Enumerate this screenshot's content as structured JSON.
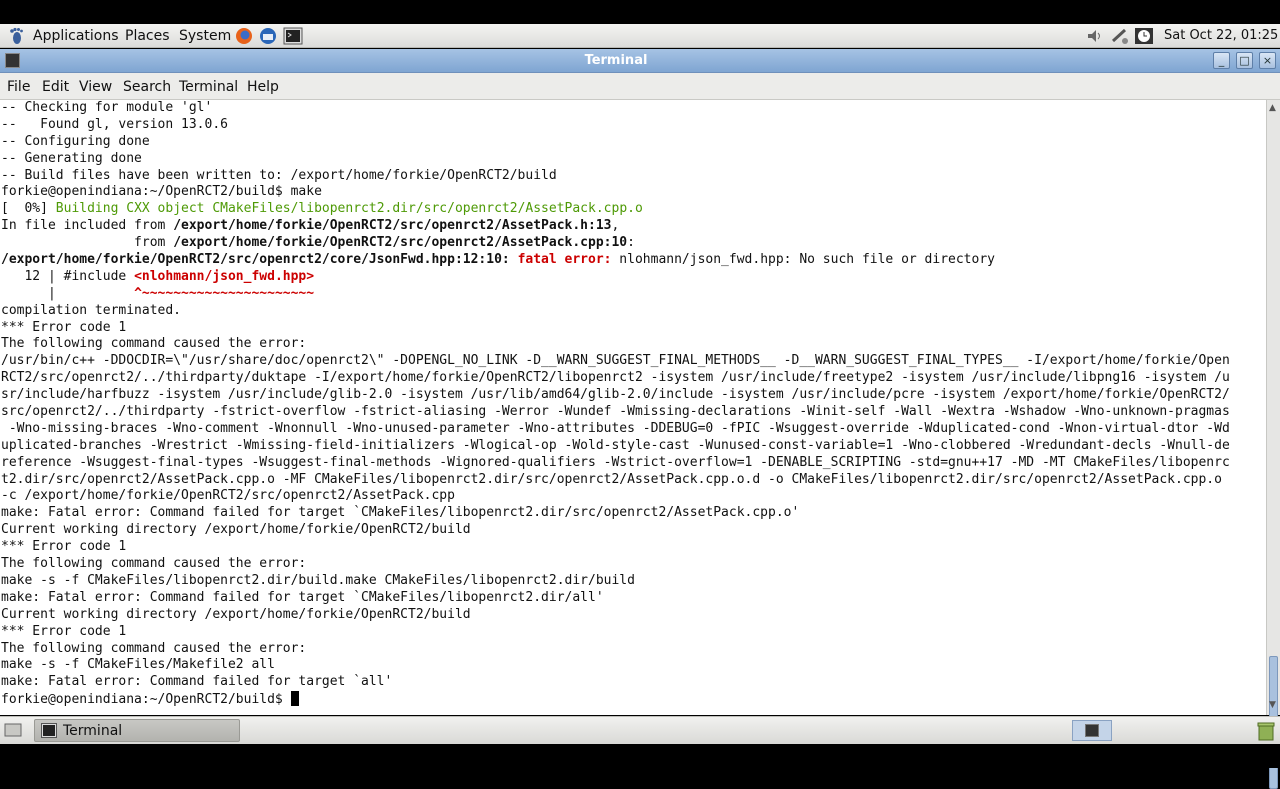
{
  "top_panel": {
    "menus": [
      "Applications",
      "Places",
      "System"
    ],
    "clock": "Sat Oct 22, 01:25"
  },
  "window": {
    "title": "Terminal",
    "menubar": [
      "File",
      "Edit",
      "View",
      "Search",
      "Terminal",
      "Help"
    ]
  },
  "terminal": {
    "prompt_last": "forkie@openindiana:~/OpenRCT2/build$ ",
    "lines": [
      [
        {
          "t": "-- Checking for module 'gl'"
        }
      ],
      [
        {
          "t": "--   Found gl, version 13.0.6"
        }
      ],
      [
        {
          "t": "-- Configuring done"
        }
      ],
      [
        {
          "t": "-- Generating done"
        }
      ],
      [
        {
          "t": "-- Build files have been written to: /export/home/forkie/OpenRCT2/build"
        }
      ],
      [
        {
          "t": "forkie@openindiana:~/OpenRCT2/build$ make"
        }
      ],
      [
        {
          "t": "[  0%] "
        },
        {
          "t": "Building CXX object CMakeFiles/libopenrct2.dir/src/openrct2/AssetPack.cpp.o",
          "s": "g"
        }
      ],
      [
        {
          "t": "In file included from "
        },
        {
          "t": "/export/home/forkie/OpenRCT2/src/openrct2/AssetPack.h:13",
          "s": "b"
        },
        {
          "t": ","
        }
      ],
      [
        {
          "t": "                 from "
        },
        {
          "t": "/export/home/forkie/OpenRCT2/src/openrct2/AssetPack.cpp:10",
          "s": "b"
        },
        {
          "t": ":"
        }
      ],
      [
        {
          "t": "/export/home/forkie/OpenRCT2/src/openrct2/core/JsonFwd.hpp:12:10:",
          "s": "b"
        },
        {
          "t": " "
        },
        {
          "t": "fatal error:",
          "s": "r"
        },
        {
          "t": " nlohmann/json_fwd.hpp: No such file or directory"
        }
      ],
      [
        {
          "t": "   12 | #include "
        },
        {
          "t": "<nlohmann/json_fwd.hpp>",
          "s": "r"
        }
      ],
      [
        {
          "t": "      |          "
        },
        {
          "t": "^~~~~~~~~~~~~~~~~~~~~~~",
          "s": "r"
        }
      ],
      [
        {
          "t": "compilation terminated."
        }
      ],
      [
        {
          "t": "*** Error code 1"
        }
      ],
      [
        {
          "t": "The following command caused the error:"
        }
      ],
      [
        {
          "t": "/usr/bin/c++ -DDOCDIR=\\\"/usr/share/doc/openrct2\\\" -DOPENGL_NO_LINK -D__WARN_SUGGEST_FINAL_METHODS__ -D__WARN_SUGGEST_FINAL_TYPES__ -I/export/home/forkie/Open"
        }
      ],
      [
        {
          "t": "RCT2/src/openrct2/../thirdparty/duktape -I/export/home/forkie/OpenRCT2/libopenrct2 -isystem /usr/include/freetype2 -isystem /usr/include/libpng16 -isystem /u"
        }
      ],
      [
        {
          "t": "sr/include/harfbuzz -isystem /usr/include/glib-2.0 -isystem /usr/lib/amd64/glib-2.0/include -isystem /usr/include/pcre -isystem /export/home/forkie/OpenRCT2/"
        }
      ],
      [
        {
          "t": "src/openrct2/../thirdparty -fstrict-overflow -fstrict-aliasing -Werror -Wundef -Wmissing-declarations -Winit-self -Wall -Wextra -Wshadow -Wno-unknown-pragmas"
        }
      ],
      [
        {
          "t": " -Wno-missing-braces -Wno-comment -Wnonnull -Wno-unused-parameter -Wno-attributes -DDEBUG=0 -fPIC -Wsuggest-override -Wduplicated-cond -Wnon-virtual-dtor -Wd"
        }
      ],
      [
        {
          "t": "uplicated-branches -Wrestrict -Wmissing-field-initializers -Wlogical-op -Wold-style-cast -Wunused-const-variable=1 -Wno-clobbered -Wredundant-decls -Wnull-de"
        }
      ],
      [
        {
          "t": "reference -Wsuggest-final-types -Wsuggest-final-methods -Wignored-qualifiers -Wstrict-overflow=1 -DENABLE_SCRIPTING -std=gnu++17 -MD -MT CMakeFiles/libopenrc"
        }
      ],
      [
        {
          "t": "t2.dir/src/openrct2/AssetPack.cpp.o -MF CMakeFiles/libopenrct2.dir/src/openrct2/AssetPack.cpp.o.d -o CMakeFiles/libopenrct2.dir/src/openrct2/AssetPack.cpp.o"
        }
      ],
      [
        {
          "t": "-c /export/home/forkie/OpenRCT2/src/openrct2/AssetPack.cpp"
        }
      ],
      [
        {
          "t": "make: Fatal error: Command failed for target `CMakeFiles/libopenrct2.dir/src/openrct2/AssetPack.cpp.o'"
        }
      ],
      [
        {
          "t": "Current working directory /export/home/forkie/OpenRCT2/build"
        }
      ],
      [
        {
          "t": "*** Error code 1"
        }
      ],
      [
        {
          "t": "The following command caused the error:"
        }
      ],
      [
        {
          "t": "make -s -f CMakeFiles/libopenrct2.dir/build.make CMakeFiles/libopenrct2.dir/build"
        }
      ],
      [
        {
          "t": "make: Fatal error: Command failed for target `CMakeFiles/libopenrct2.dir/all'"
        }
      ],
      [
        {
          "t": "Current working directory /export/home/forkie/OpenRCT2/build"
        }
      ],
      [
        {
          "t": "*** Error code 1"
        }
      ],
      [
        {
          "t": "The following command caused the error:"
        }
      ],
      [
        {
          "t": "make -s -f CMakeFiles/Makefile2 all"
        }
      ],
      [
        {
          "t": "make: Fatal error: Command failed for target `all'"
        }
      ]
    ]
  },
  "taskbar": {
    "task_label": "Terminal"
  }
}
